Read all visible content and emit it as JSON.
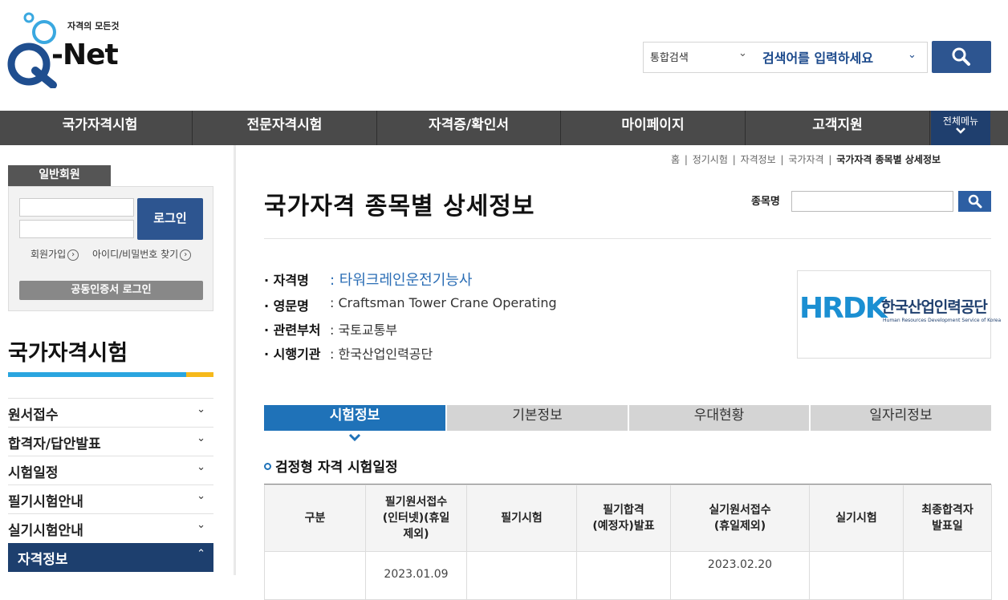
{
  "header": {
    "logo_tagline": "자격의 모든것",
    "logo_word": "-Net",
    "search_scope": "통합검색",
    "search_placeholder": "검색어를 입력하세요"
  },
  "nav": {
    "items": [
      "국가자격시험",
      "전문자격시험",
      "자격증/확인서",
      "마이페이지",
      "고객지원"
    ],
    "all_menu": "전체메뉴"
  },
  "sidebar": {
    "member_tab": "일반회원",
    "login_button": "로그인",
    "join_link": "회원가입",
    "find_link": "아이디/비밀번호 찾기",
    "cert_login": "공동인증서 로그인",
    "section_title": "국가자격시험",
    "items": [
      {
        "label": "원서접수",
        "active": false
      },
      {
        "label": "합격자/답안발표",
        "active": false
      },
      {
        "label": "시험일정",
        "active": false
      },
      {
        "label": "필기시험안내",
        "active": false
      },
      {
        "label": "실기시험안내",
        "active": false
      },
      {
        "label": "자격정보",
        "active": true
      }
    ]
  },
  "breadcrumb": [
    "홈",
    "정기시험",
    "자격정보",
    "국가자격",
    "국가자격 종목별 상세정보"
  ],
  "page": {
    "title": "국가자격 종목별 상세정보",
    "search_label": "종목명"
  },
  "info": {
    "rows": [
      {
        "key": "· 자격명",
        "value": ": 타워크레인운전기능사",
        "link": true
      },
      {
        "key": "· 영문명",
        "value": ": Craftsman Tower Crane Operating",
        "link": false
      },
      {
        "key": "· 관련부처",
        "value": ": 국토교통부",
        "link": false
      },
      {
        "key": "· 시행기관",
        "value": ": 한국산업인력공단",
        "link": false
      }
    ],
    "org_logo_text": "HRDK",
    "org_name_ko": "한국산업인력공단",
    "org_name_en": "Human Resources Development Service of Korea"
  },
  "tabs": [
    {
      "label": "시험정보",
      "active": true
    },
    {
      "label": "기본정보",
      "active": false
    },
    {
      "label": "우대현황",
      "active": false
    },
    {
      "label": "일자리정보",
      "active": false
    }
  ],
  "section_title": "검정형 자격 시험일정",
  "table": {
    "headers": [
      "구분",
      "필기원서접수\n(인터넷)(휴일\n제외)",
      "필기시험",
      "필기합격\n(예정자)발표",
      "실기원서접수\n(휴일제외)",
      "실기시험",
      "최종합격자\n발표일"
    ],
    "rows": [
      [
        "",
        "2023.01.09",
        "",
        "",
        "2023.02.20",
        "",
        ""
      ]
    ]
  },
  "colors": {
    "navy": "#1d3f6e",
    "blue": "#1f72b8",
    "nav_bg": "#4a4a4a",
    "link": "#2a6db5"
  }
}
